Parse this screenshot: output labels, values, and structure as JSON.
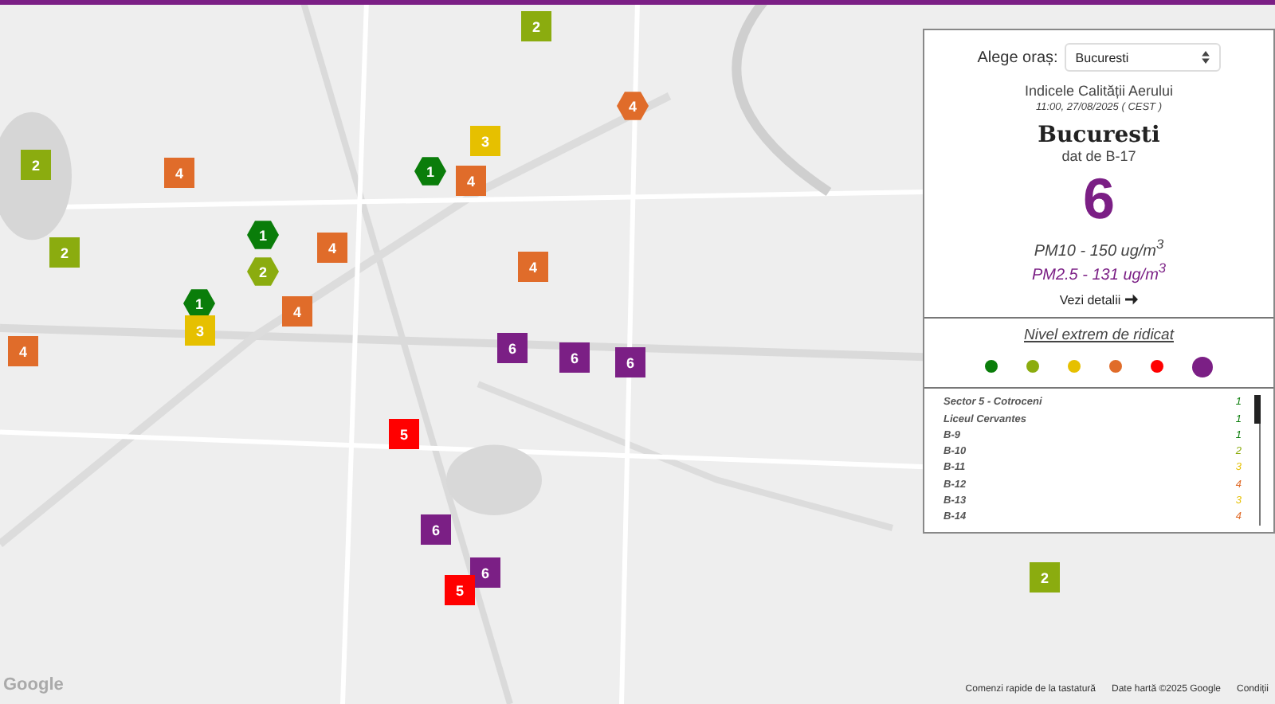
{
  "map": {
    "markers": [
      {
        "kind": "square",
        "value": "2",
        "color": "#8bac0f"
      },
      {
        "kind": "hexagon",
        "value": "4",
        "color": "#e06c2a"
      },
      {
        "kind": "square",
        "value": "3",
        "color": "#e6c000"
      },
      {
        "kind": "hexagon",
        "value": "1",
        "color": "#0a7d0a"
      },
      {
        "kind": "square",
        "value": "4",
        "color": "#e06c2a"
      },
      {
        "kind": "square",
        "value": "2",
        "color": "#8bac0f"
      },
      {
        "kind": "square",
        "value": "4",
        "color": "#e06c2a"
      },
      {
        "kind": "hexagon",
        "value": "1",
        "color": "#0a7d0a"
      },
      {
        "kind": "square",
        "value": "4",
        "color": "#e06c2a"
      },
      {
        "kind": "square",
        "value": "2",
        "color": "#8bac0f"
      },
      {
        "kind": "hexagon",
        "value": "2",
        "color": "#8bac0f"
      },
      {
        "kind": "square",
        "value": "4",
        "color": "#e06c2a"
      },
      {
        "kind": "hexagon",
        "value": "1",
        "color": "#0a7d0a"
      },
      {
        "kind": "square",
        "value": "3",
        "color": "#e6c000"
      },
      {
        "kind": "square",
        "value": "4",
        "color": "#e06c2a"
      },
      {
        "kind": "square",
        "value": "4",
        "color": "#e06c2a"
      },
      {
        "kind": "square",
        "value": "6",
        "color": "#7b1f85"
      },
      {
        "kind": "square",
        "value": "6",
        "color": "#7b1f85"
      },
      {
        "kind": "square",
        "value": "6",
        "color": "#7b1f85"
      },
      {
        "kind": "square",
        "value": "5",
        "color": "#ff0000"
      },
      {
        "kind": "square",
        "value": "6",
        "color": "#7b1f85"
      },
      {
        "kind": "square",
        "value": "6",
        "color": "#7b1f85"
      },
      {
        "kind": "square",
        "value": "5",
        "color": "#ff0000"
      },
      {
        "kind": "square",
        "value": "2",
        "color": "#8bac0f"
      }
    ],
    "google_logo": "Google",
    "attribution": [
      "Comenzi rapide de la tastatură",
      "Date hartă ©2025 Google",
      "Condiții"
    ]
  },
  "panel": {
    "city_label": "Alege oraș:",
    "city_select": "Bucuresti",
    "title": "Indicele Calității Aerului",
    "timestamp": "11:00, 27/08/2025 ( CEST )",
    "city": "Bucuresti",
    "source": "dat de B-17",
    "index": {
      "value": "6",
      "color": "#7b1f85"
    },
    "pm10": "PM10 - 150 ug/m$^{3}$",
    "pm25": "PM2.5 - 131 ug/m$^{3}$",
    "details_link": "Vezi detalii",
    "level_name": "Nivel extrem de ridicat",
    "legend": [
      {
        "color": "#0a7d0a",
        "selected": false
      },
      {
        "color": "#8bac0f",
        "selected": false
      },
      {
        "color": "#e6c000",
        "selected": false
      },
      {
        "color": "#e06c2a",
        "selected": false
      },
      {
        "color": "#ff0000",
        "selected": false
      },
      {
        "color": "#7b1f85",
        "selected": true
      }
    ],
    "stations": [
      {
        "name": "Sector 5 - Cotroceni",
        "value": "1",
        "color": "#0a7d0a"
      },
      {
        "name": "Liceul Cervantes",
        "value": "1",
        "color": "#0a7d0a"
      },
      {
        "name": "B-9",
        "value": "1",
        "color": "#0a7d0a"
      },
      {
        "name": "B-10",
        "value": "2",
        "color": "#8bac0f"
      },
      {
        "name": "B-11",
        "value": "3",
        "color": "#e6c000"
      },
      {
        "name": "B-12",
        "value": "4",
        "color": "#e06c2a"
      },
      {
        "name": "B-13",
        "value": "3",
        "color": "#e6c000"
      },
      {
        "name": "B-14",
        "value": "4",
        "color": "#e06c2a"
      }
    ]
  }
}
